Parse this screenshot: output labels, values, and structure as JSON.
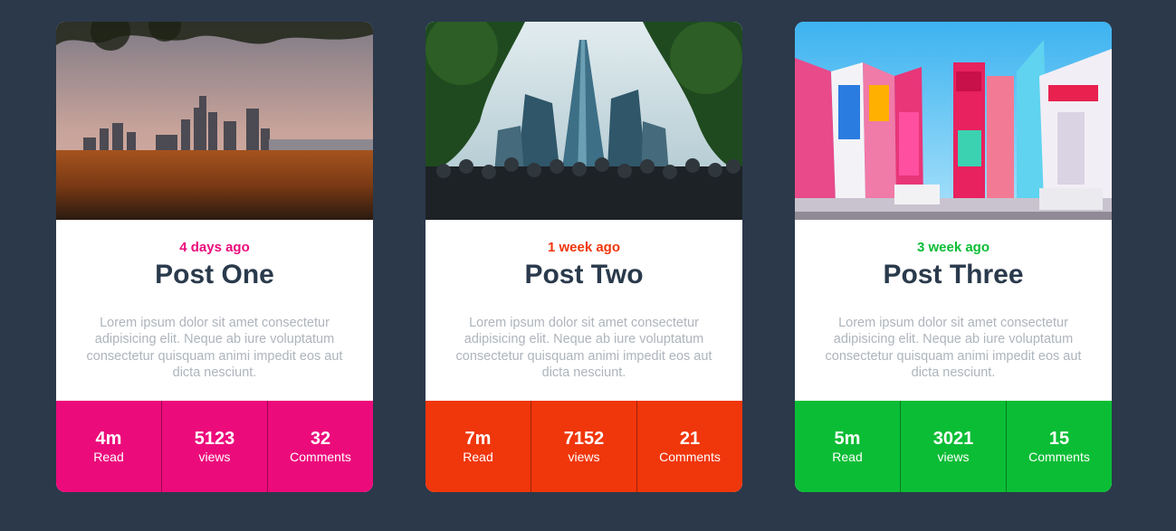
{
  "posts": [
    {
      "date": "4 days ago",
      "title": "Post One",
      "description": "Lorem ipsum dolor sit amet consectetur adipisicing elit. Neque ab iure voluptatum consectetur quisquam animi impedit eos aut dicta nesciunt.",
      "accent": "#ec0b7b",
      "stats": [
        {
          "value": "4m",
          "label": "Read"
        },
        {
          "value": "5123",
          "label": "views"
        },
        {
          "value": "32",
          "label": "Comments"
        }
      ]
    },
    {
      "date": "1 week ago",
      "title": "Post Two",
      "description": "Lorem ipsum dolor sit amet consectetur adipisicing elit. Neque ab iure voluptatum consectetur quisquam animi impedit eos aut dicta nesciunt.",
      "accent": "#f0360b",
      "stats": [
        {
          "value": "7m",
          "label": "Read"
        },
        {
          "value": "7152",
          "label": "views"
        },
        {
          "value": "21",
          "label": "Comments"
        }
      ]
    },
    {
      "date": "3 week ago",
      "title": "Post Three",
      "description": "Lorem ipsum dolor sit amet consectetur adipisicing elit. Neque ab iure voluptatum consectetur quisquam animi impedit eos aut dicta nesciunt.",
      "accent": "#0bbd35",
      "stats": [
        {
          "value": "5m",
          "label": "Read"
        },
        {
          "value": "3021",
          "label": "views"
        },
        {
          "value": "15",
          "label": "Comments"
        }
      ]
    }
  ],
  "colors": {
    "background": "#2b394b",
    "title": "#2a3a4c",
    "description": "#aeb4bc"
  }
}
